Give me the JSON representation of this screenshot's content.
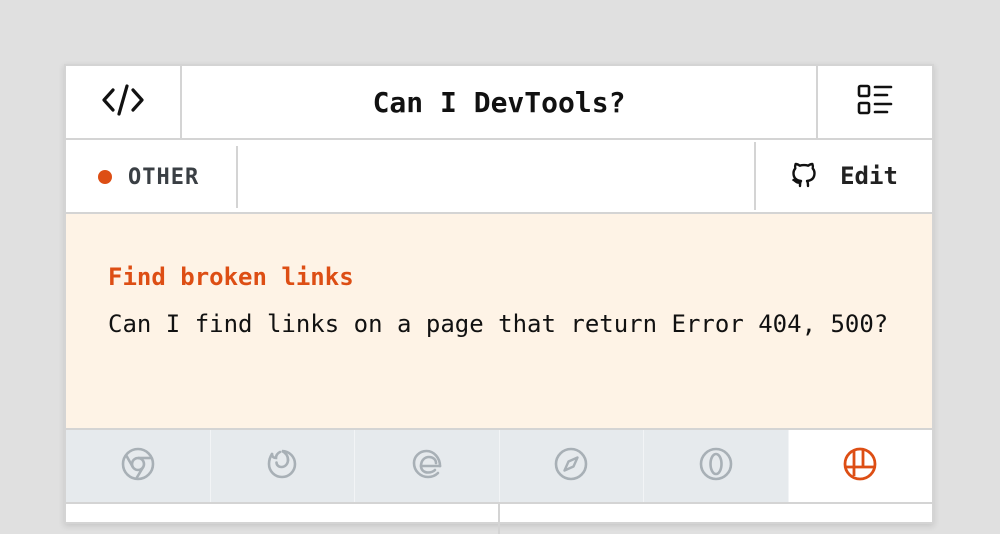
{
  "header": {
    "title": "Can I DevTools?",
    "left_icon": "code-brackets-icon",
    "right_icon": "list-view-icon"
  },
  "meta": {
    "category": "OTHER",
    "category_color": "#dd4e14",
    "edit_label": "Edit",
    "edit_icon": "github-icon"
  },
  "feature": {
    "heading": "Find broken links",
    "description": "Can I find links on a page that return Error 404, 500?"
  },
  "browsers": [
    {
      "icon": "chrome-icon",
      "active": false
    },
    {
      "icon": "firefox-icon",
      "active": false
    },
    {
      "icon": "edge-icon",
      "active": false
    },
    {
      "icon": "safari-icon",
      "active": false
    },
    {
      "icon": "opera-icon",
      "active": false
    },
    {
      "icon": "polypane-icon",
      "active": true
    }
  ],
  "colors": {
    "accent": "#dd4e14",
    "highlight_bg": "#fef3e6",
    "inactive_tab_bg": "#e6eaed",
    "icon_gray": "#a8b0b6"
  }
}
